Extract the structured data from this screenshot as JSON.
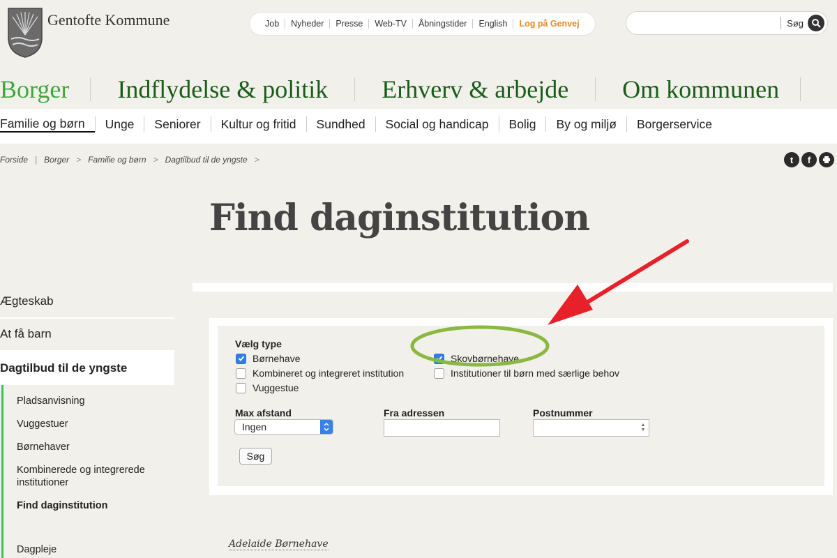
{
  "header": {
    "logo_text": "Gentofte Kommune",
    "utility_links": [
      "Job",
      "Nyheder",
      "Presse",
      "Web-TV",
      "Åbningstider",
      "English",
      "Log på Genvej"
    ],
    "search": {
      "value": "",
      "placeholder": "",
      "button_label": "Søg"
    }
  },
  "main_nav": {
    "items": [
      {
        "label": "Borger",
        "active": true
      },
      {
        "label": "Indflydelse & politik",
        "active": false
      },
      {
        "label": "Erhverv & arbejde",
        "active": false
      },
      {
        "label": "Om kommunen",
        "active": false
      }
    ]
  },
  "sub_nav": {
    "items": [
      "Familie og børn",
      "Unge",
      "Seniorer",
      "Kultur og fritid",
      "Sundhed",
      "Social og handicap",
      "Bolig",
      "By og miljø",
      "Borgerservice"
    ],
    "active": "Familie og børn"
  },
  "breadcrumb": [
    "Forside",
    "Borger",
    "Familie og børn",
    "Dagtilbud til de yngste"
  ],
  "social_icons": [
    "twitter-icon",
    "facebook-icon",
    "print-icon"
  ],
  "page_title": "Find daginstitution",
  "sidebar": {
    "top_items": [
      "Ægteskab",
      "At få barn"
    ],
    "active_section": "Dagtilbud til de yngste",
    "sub_items": [
      {
        "label": "Pladsanvisning",
        "current": false
      },
      {
        "label": "Vuggestuer",
        "current": false
      },
      {
        "label": "Børnehaver",
        "current": false
      },
      {
        "label": "Kombinerede og integrerede institutioner",
        "current": false
      },
      {
        "label": "Find daginstitution",
        "current": true
      },
      {
        "label": "Dagpleje",
        "current": false
      }
    ]
  },
  "form": {
    "type_label": "Vælg type",
    "types": [
      {
        "label": "Børnehave",
        "checked": true
      },
      {
        "label": "Kombineret og integreret institution",
        "checked": false
      },
      {
        "label": "Vuggestue",
        "checked": false
      },
      {
        "label": "Skovbørnehave",
        "checked": true
      },
      {
        "label": "Institutioner til børn med særlige behov",
        "checked": false
      }
    ],
    "max_distance_label": "Max afstand",
    "max_distance_value": "Ingen",
    "address_label": "Fra adressen",
    "address_value": "",
    "postal_label": "Postnummer",
    "postal_value": "",
    "submit_label": "Søg"
  },
  "results": [
    "Adelaide Børnehave"
  ],
  "annotations": {
    "arrow_color": "#e8202a",
    "circle_color": "#8ab840"
  },
  "colors": {
    "brand_green": "#1a5c1a",
    "active_green": "#3fa73f",
    "sidebar_accent": "#3cc25e",
    "genvej_orange": "#e8892a"
  }
}
